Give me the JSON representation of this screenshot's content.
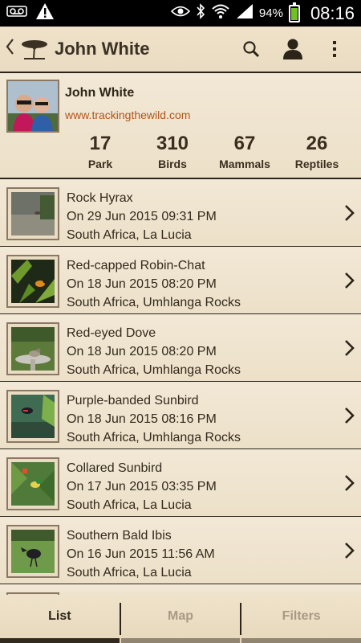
{
  "status_bar": {
    "battery_text": "94%",
    "time": "08:16",
    "icons": [
      "voicemail-icon",
      "warning-icon",
      "eye-icon",
      "bluetooth-icon",
      "wifi-icon",
      "signal-icon",
      "battery-icon"
    ]
  },
  "action_bar": {
    "title": "John White",
    "icons": [
      "back-chevron-icon",
      "acacia-tree-logo-icon",
      "search-icon",
      "profile-icon",
      "overflow-menu-icon"
    ]
  },
  "profile": {
    "name": "John White",
    "url": "www.trackingthewild.com",
    "stats": [
      {
        "value": "17",
        "label": "Park"
      },
      {
        "value": "310",
        "label": "Birds"
      },
      {
        "value": "67",
        "label": "Mammals"
      },
      {
        "value": "26",
        "label": "Reptiles"
      }
    ]
  },
  "sightings": [
    {
      "name": "Rock Hyrax",
      "date": "On 29 Jun 2015 09:31 PM",
      "location": "South Africa, La Lucia"
    },
    {
      "name": "Red-capped Robin-Chat",
      "date": "On 18 Jun 2015 08:20 PM",
      "location": "South Africa, Umhlanga Rocks"
    },
    {
      "name": "Red-eyed Dove",
      "date": "On 18 Jun 2015 08:20 PM",
      "location": "South Africa, Umhlanga Rocks"
    },
    {
      "name": "Purple-banded Sunbird",
      "date": "On 18 Jun 2015 08:16 PM",
      "location": "South Africa, Umhlanga Rocks"
    },
    {
      "name": "Collared Sunbird",
      "date": "On 17 Jun 2015 03:35 PM",
      "location": "South Africa, La Lucia"
    },
    {
      "name": "Southern Bald Ibis",
      "date": "On 16 Jun 2015 11:56 AM",
      "location": "South Africa, La Lucia"
    }
  ],
  "tabs": [
    {
      "label": "List",
      "active": true
    },
    {
      "label": "Map",
      "active": false
    },
    {
      "label": "Filters",
      "active": false
    }
  ],
  "colors": {
    "background": "#efe4cf",
    "text_dark": "#3a2e1f",
    "url": "#b4541a",
    "tab_inactive": "#a89a85",
    "battery": "#6fc21f"
  }
}
